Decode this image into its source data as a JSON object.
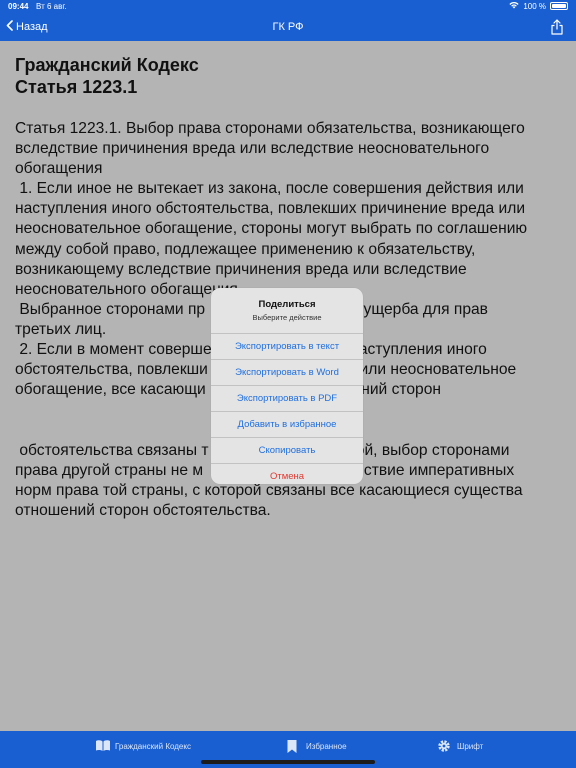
{
  "status": {
    "time": "09:44",
    "date": "Вт 6 авг.",
    "battery": "100 %"
  },
  "nav": {
    "back_label": "Назад",
    "title": "ГК РФ"
  },
  "document": {
    "title": "Гражданский Кодекс\nСтатья 1223.1",
    "text": "Статья 1223.1. Выбор права сторонами обязательства, возникающего\nвследствие причинения вреда или вследствие неосновательного\nобогащения\n 1. Если иное не вытекает из закона, после совершения действия или\nнаступления иного обстоятельства, повлекших причинение вреда или\nнеосновательное обогащение, стороны могут выбрать по соглашению\nмежду собой право, подлежащее применению к обязательству,\nвозникающему вследствие причинения вреда или вследствие\nнеосновательного обогащения.\n Выбранное сторонами пр                                ез ущерба для прав\nтретьих лиц.\n 2. Если в момент соверше                                наступления иного\nобстоятельства, повлекши                                а или неосновательное\nобогащение, все касающи                               шений сторон\n\n\n обстоятельства связаны т                                ной, выбор сторонами\nправа другой страны не м                               действие императивных\nнорм права той страны, с которой связаны все касающиеся существа\nотношений сторон обстоятельства."
  },
  "dialog": {
    "title": "Поделиться",
    "subtitle": "Выберите действие",
    "items": [
      {
        "label": "Экспортировать в текст"
      },
      {
        "label": "Экспортировать в Word"
      },
      {
        "label": "Экспортировать в PDF"
      },
      {
        "label": "Добавить в избранное"
      },
      {
        "label": "Скопировать"
      },
      {
        "label": "Отмена",
        "style": "destructive"
      }
    ]
  },
  "tabs": [
    {
      "label": "Гражданский Кодекс",
      "icon": "book-icon"
    },
    {
      "label": "Избранное",
      "icon": "bookmark-icon"
    },
    {
      "label": "Шрифт",
      "icon": "gear-icon"
    }
  ],
  "colors": {
    "accent": "#1a5fd1",
    "link": "#1f6fe0",
    "destructive": "#e0382f"
  }
}
